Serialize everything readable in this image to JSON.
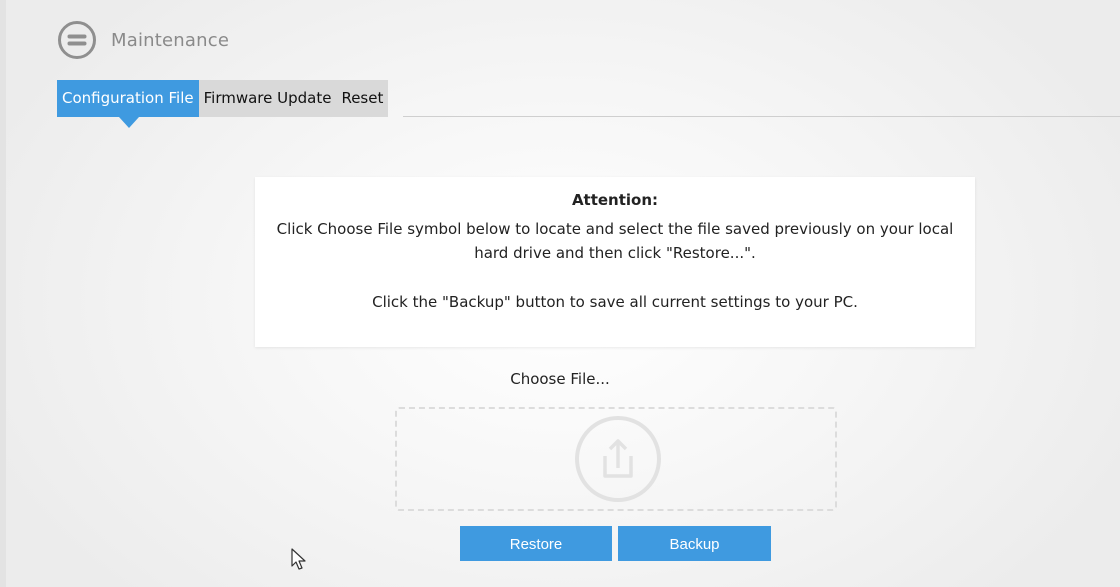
{
  "header": {
    "icon": "menu-lines-icon",
    "title": "Maintenance"
  },
  "tabs": [
    {
      "label": "Configuration File",
      "active": true
    },
    {
      "label": "Firmware Update",
      "active": false
    },
    {
      "label": "Reset",
      "active": false
    }
  ],
  "notice": {
    "title": "Attention:",
    "line1": "Click Choose File symbol below to locate and select the file saved previously on your local hard drive and then click \"Restore...\".",
    "line2": "Click the \"Backup\" button to save all current settings to your PC."
  },
  "file": {
    "choose_label": "Choose File...",
    "upload_icon": "upload-icon"
  },
  "buttons": {
    "restore": "Restore",
    "backup": "Backup"
  },
  "colors": {
    "accent": "#3f9ae0",
    "tab_inactive": "#d9d9d9",
    "title_gray": "#8a8a8a"
  }
}
